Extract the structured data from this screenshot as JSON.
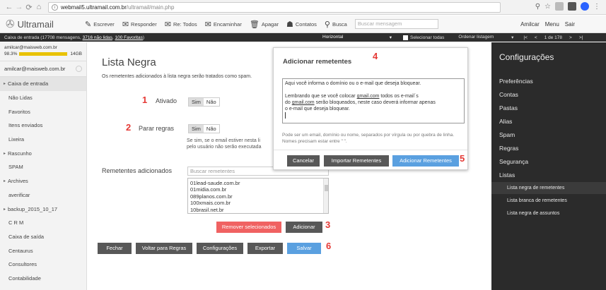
{
  "browser": {
    "host": "webmail5.ultramail.com.br",
    "path": "/ultramail/main.php"
  },
  "app": {
    "name": "Ultramail",
    "toolbar": [
      {
        "id": "escrever",
        "label": "Escrever",
        "icon": "compose-icon"
      },
      {
        "id": "responder",
        "label": "Responder",
        "icon": "reply-icon"
      },
      {
        "id": "re-todos",
        "label": "Re: Todos",
        "icon": "reply-all-icon"
      },
      {
        "id": "encaminhar",
        "label": "Encaminhar",
        "icon": "forward-icon"
      },
      {
        "id": "apagar",
        "label": "Apagar",
        "icon": "trash-icon"
      },
      {
        "id": "contatos",
        "label": "Contatos",
        "icon": "contacts-icon"
      },
      {
        "id": "busca",
        "label": "Busca",
        "icon": "search-icon"
      }
    ],
    "search_placeholder": "Buscar mensagem",
    "user": "Amilcar",
    "menu": "Menu",
    "logout": "Sair"
  },
  "statusbar": {
    "inbox": "Caixa de entrada (17708 mensagens",
    "unread": "3716 não lidas",
    "favorites": "100 Favoritas",
    "sep1": ", ",
    "sep2": ", ",
    "end": ")",
    "view": "Horizontal",
    "select_all": "Selecionar todas",
    "order": "Ordenar listagem",
    "first": "|<",
    "prev": "<",
    "page": "1 de 178",
    "next": ">",
    "last": ">|"
  },
  "sidebar": {
    "email": "amilcar@maisweb.com.br",
    "quota_percent": "98.3%",
    "quota_fill": 0.983,
    "quota_total": "14GB",
    "account": "amilcar@maisweb.com.br",
    "folders": [
      {
        "label": "Caixa de entrada",
        "expandable": true,
        "active": true
      },
      {
        "label": "Não Lidas"
      },
      {
        "label": "Favoritos"
      },
      {
        "label": "Itens enviados"
      },
      {
        "label": "Lixeira"
      },
      {
        "label": "Rascunho",
        "expandable": true
      },
      {
        "label": "SPAM"
      },
      {
        "label": "Archives",
        "expandable": true
      },
      {
        "label": "averificar"
      },
      {
        "label": "backup_2015_10_17",
        "expandable": true
      },
      {
        "label": "C R M"
      },
      {
        "label": "Caixa de saída"
      },
      {
        "label": "Centaurus"
      },
      {
        "label": "Consultores"
      },
      {
        "label": "Contabilidade"
      }
    ]
  },
  "main": {
    "title": "Lista Negra",
    "description": "Os remetentes adicionados à lista negra serão tratados como spam.",
    "ativado_label": "Ativado",
    "parar_label": "Parar regras",
    "sim": "Sim",
    "nao": "Não",
    "note_line1": "Se sim, se o email estiver nesta li",
    "note_line2": "pelo usuário não serão executada",
    "remetentes_label": "Remetentes adicionados",
    "search_placeholder": "Buscar remetentes",
    "senders": [
      "01lead-saude.com.br",
      "01midia.com.br",
      "089planos.com.br",
      "100xmais.com.br",
      "10brasil.net.br"
    ],
    "remove_button": "Remover selecionados",
    "add_button": "Adicionar",
    "fechar": "Fechar",
    "voltar": "Voltar para Regras",
    "configuracoes": "Configurações",
    "exportar": "Exportar",
    "salvar": "Salvar"
  },
  "annotations": {
    "n1": "1",
    "n2": "2",
    "n3": "3",
    "n4": "4",
    "n5": "5",
    "n6": "6"
  },
  "dialog": {
    "title": "Adicionar remetentes",
    "text_line1_pre": "Aqui você informa o domínio ou o e-mail que deseja bloquear.",
    "text_line2_pre": "Lembrando que se você colocar ",
    "text_link1": "gmail.com",
    "text_line2_post": " todos os e-mail´s",
    "text_line3_pre": "do ",
    "text_link2": "gmail.com",
    "text_line3_post": " serão bloqueados, neste caso deverá informar apenas",
    "text_line4": "o e-mail que deseja bloquear.",
    "hint": "Pode ser um email, domínio ou nome, separados por vírgula ou por quebra de linha. Nomes precisam estar entre \" \".",
    "cancel": "Cancelar",
    "import": "Importar Remetentes",
    "add": "Adicionar Remetentes"
  },
  "settings": {
    "title": "Configurações",
    "items": [
      "Preferências",
      "Contas",
      "Pastas",
      "Alias",
      "Spam",
      "Regras",
      "Segurança",
      "Listas"
    ],
    "subitems": [
      "Lista negra de remetentes",
      "Lista branca de remetentes",
      "Lista negra de assuntos"
    ]
  },
  "colors": {
    "annotation": "#e53935",
    "danger": "#f06262",
    "primary": "#5aa0e0",
    "dark": "#585858",
    "quota": "#e8c200"
  }
}
